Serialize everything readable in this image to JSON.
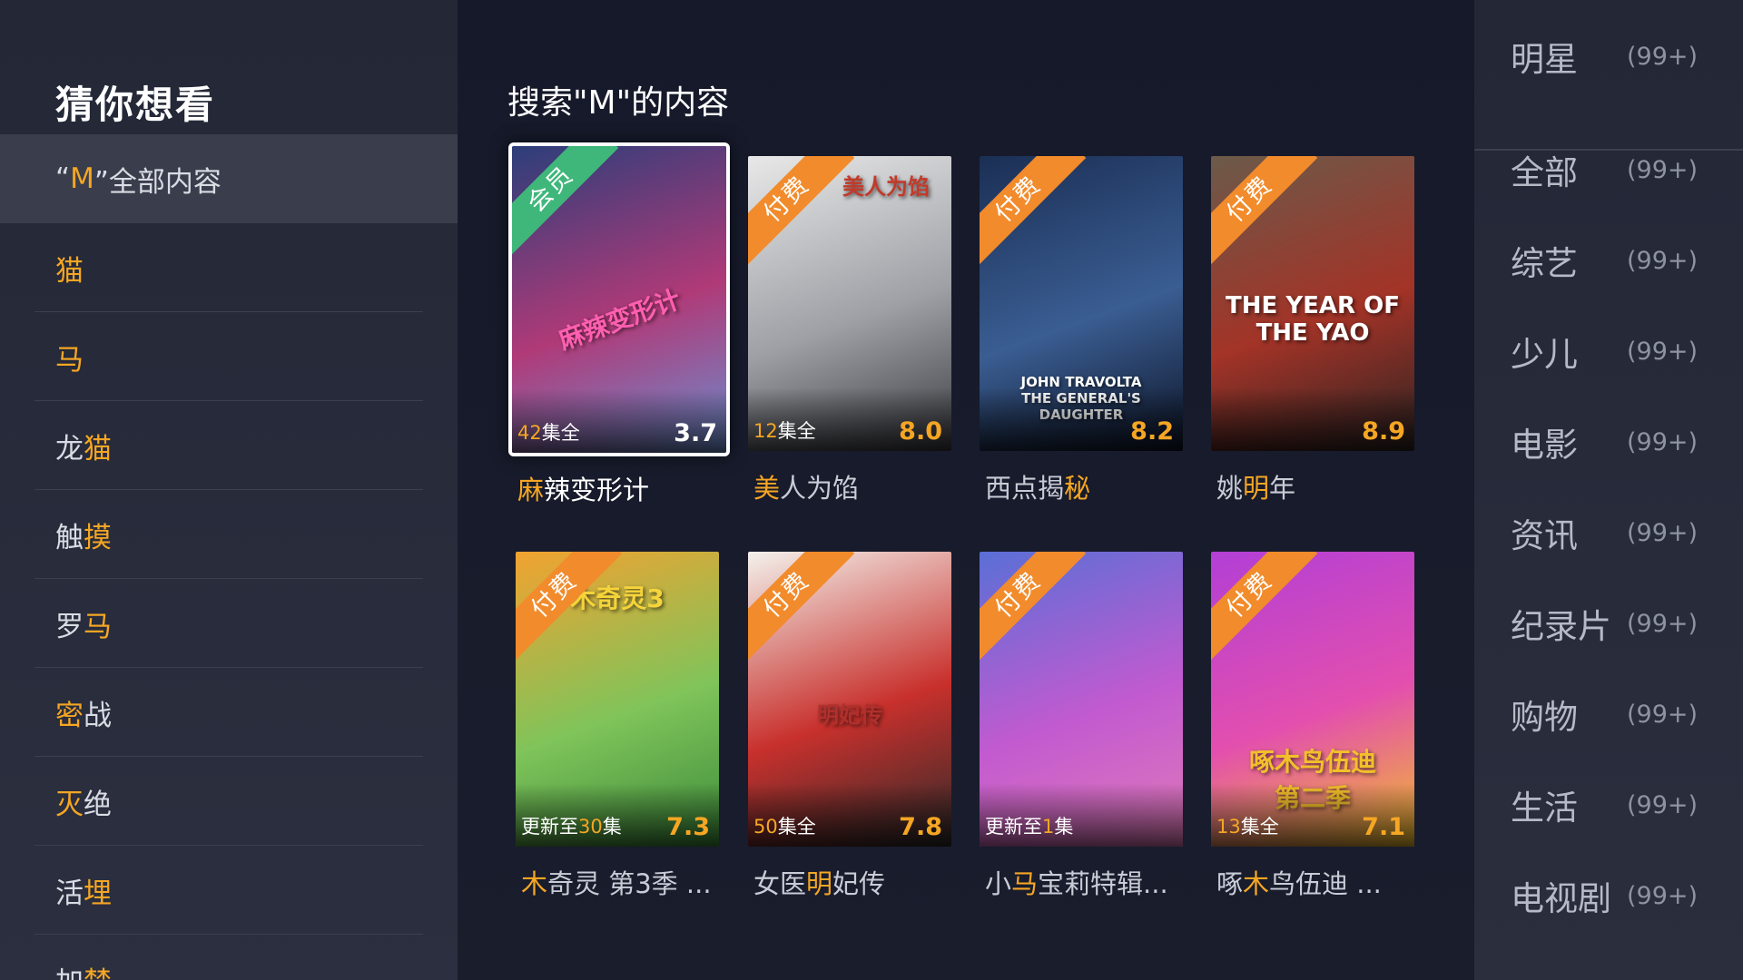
{
  "left": {
    "title": "猜你想看",
    "all": {
      "pre": "“",
      "hl": "M",
      "post": "”全部内容"
    },
    "items": [
      {
        "hl": "猫",
        "rest": ""
      },
      {
        "hl": "马",
        "rest": ""
      },
      {
        "pre": "龙",
        "hl": "猫",
        "rest": ""
      },
      {
        "pre": "触",
        "hl": "摸",
        "rest": ""
      },
      {
        "pre": "罗",
        "hl": "马",
        "rest": ""
      },
      {
        "hl": "密",
        "rest": "战"
      },
      {
        "hl": "灭",
        "rest": "绝"
      },
      {
        "pre": "活",
        "hl": "埋",
        "rest": ""
      },
      {
        "pre": "加",
        "hl": "禁",
        "rest": ""
      }
    ]
  },
  "main": {
    "title": "搜索\"M\"的内容",
    "cards": [
      {
        "badge": "会员",
        "ep_num": "42",
        "ep_text": "集全",
        "score": "3.7",
        "title_hl": "麻",
        "title_rest": "辣变形计",
        "poster_text": "麻辣变形计",
        "colors": [
          "#2c3e7a",
          "#b03a78",
          "#6a8fd0"
        ]
      },
      {
        "badge": "付费",
        "ep_num": "12",
        "ep_text": "集全",
        "score": "8.0",
        "title_hl": "美",
        "title_rest": "人为馅",
        "poster_text": "美人为馅",
        "colors": [
          "#e8e8e8",
          "#9ea0a6",
          "#3a3b40"
        ]
      },
      {
        "badge": "付费",
        "ep_pre": "西点揭",
        "ep_num": "",
        "ep_text": "",
        "score": "8.2",
        "title_pre": "西点揭",
        "title_hl": "秘",
        "title_rest": "",
        "poster_text": "JOHN TRAVOLTA\nTHE GENERAL'S DAUGHTER",
        "colors": [
          "#1b2f55",
          "#3a5d92",
          "#0d1426"
        ]
      },
      {
        "badge": "付费",
        "ep_num": "",
        "ep_text": "",
        "score": "8.9",
        "title_pre": "姚",
        "title_hl": "明",
        "title_rest": "年",
        "poster_text": "THE YEAR OF THE YAO",
        "colors": [
          "#6b5a4a",
          "#a33327",
          "#2b2322"
        ]
      },
      {
        "badge": "付费",
        "ep_pre": "更新至",
        "ep_num": "30",
        "ep_text": "集",
        "score": "7.3",
        "title_hl": "木",
        "title_rest": "奇灵 第3季 ...",
        "poster_text": "木奇灵3",
        "colors": [
          "#f2a230",
          "#7fc45a",
          "#3c8a3a"
        ]
      },
      {
        "badge": "付费",
        "ep_num": "50",
        "ep_text": "集全",
        "score": "7.8",
        "title_pre": "女医",
        "title_hl": "明",
        "title_rest": "妃传",
        "poster_text": "明妃传",
        "colors": [
          "#f4f1ec",
          "#c8302c",
          "#2a2a2a"
        ]
      },
      {
        "badge": "付费",
        "ep_pre": "更新至",
        "ep_num": "1",
        "ep_text": "集",
        "score": "",
        "title_pre": "小",
        "title_hl": "马",
        "title_rest": "宝莉特辑...",
        "poster_text": "",
        "colors": [
          "#5a6fd6",
          "#c25ad0",
          "#e07ab8"
        ]
      },
      {
        "badge": "付费",
        "ep_num": "13",
        "ep_text": "集全",
        "score": "7.1",
        "title_pre": "啄",
        "title_hl": "木",
        "title_rest": "鸟伍迪 ...",
        "poster_text": "啄木鸟伍迪\n第二季",
        "colors": [
          "#b23fd6",
          "#e34fae",
          "#f2c02a"
        ]
      }
    ]
  },
  "right": {
    "items": [
      {
        "label": "明星",
        "count": "(99+)"
      },
      {
        "label": "全部",
        "count": "(99+)"
      },
      {
        "label": "综艺",
        "count": "(99+)"
      },
      {
        "label": "少儿",
        "count": "(99+)"
      },
      {
        "label": "电影",
        "count": "(99+)"
      },
      {
        "label": "资讯",
        "count": "(99+)"
      },
      {
        "label": "纪录片",
        "count": "(99+)"
      },
      {
        "label": "购物",
        "count": "(99+)"
      },
      {
        "label": "生活",
        "count": "(99+)"
      },
      {
        "label": "电视剧",
        "count": "(99+)"
      }
    ]
  },
  "colors": {
    "accent": "#f5a623",
    "pay": "#f28b2b",
    "vip": "#3fb77a"
  }
}
